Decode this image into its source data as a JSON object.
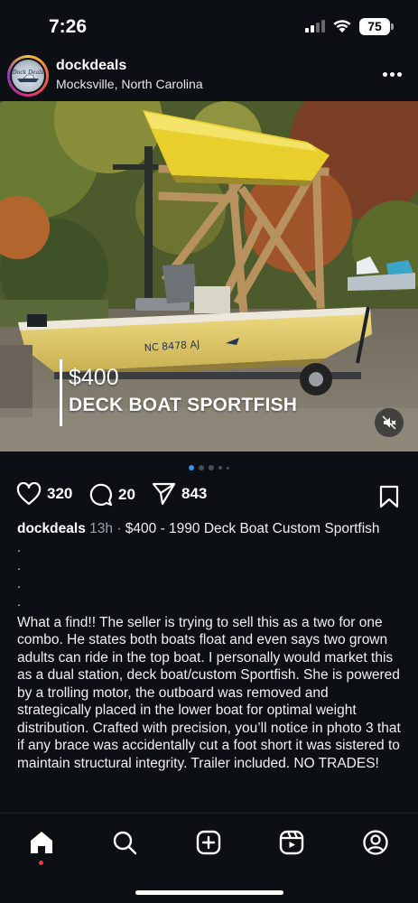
{
  "status_bar": {
    "time": "7:26",
    "battery": "75"
  },
  "post": {
    "username": "dockdeals",
    "location": "Mocksville, North Carolina",
    "avatar_text": "Dock Deals",
    "overlay": {
      "price": "$400",
      "title": "DECK BOAT SPORTFISH"
    },
    "boat_registration": "NC 8478 AJ",
    "carousel": {
      "count": 5,
      "active": 0
    },
    "likes": "320",
    "comments": "20",
    "shares": "843",
    "caption": {
      "username": "dockdeals",
      "time": "13h",
      "headline": "$400 - 1990 Deck Boat Custom Sportfish",
      "dots": [
        ".",
        ".",
        ".",
        "."
      ],
      "body": "What a find!! The seller is trying to sell this as a two for one combo. He states both boats float and even says two grown adults can ride in the top boat. I personally would market this as a dual station, deck boat/custom Sportfish. She is powered by a trolling motor, the outboard was removed and strategically placed in the lower boat for optimal weight distribution. Crafted with precision, you’ll notice in photo 3 that if any brace was accidentally cut a foot short it was sistered to maintain structural integrity. Trailer included. NO TRADES!"
    }
  },
  "icons": {
    "like": "heart-icon",
    "comment": "comment-bubble-icon",
    "share": "paper-plane-icon",
    "save": "bookmark-icon",
    "mute": "speaker-muted-icon",
    "nav": [
      "home-icon",
      "search-icon",
      "create-plus-icon",
      "reels-icon",
      "profile-icon"
    ]
  },
  "colors": {
    "background": "#0c0f14",
    "accent_dot": "#3a8ff0",
    "notification": "#ff3040"
  }
}
